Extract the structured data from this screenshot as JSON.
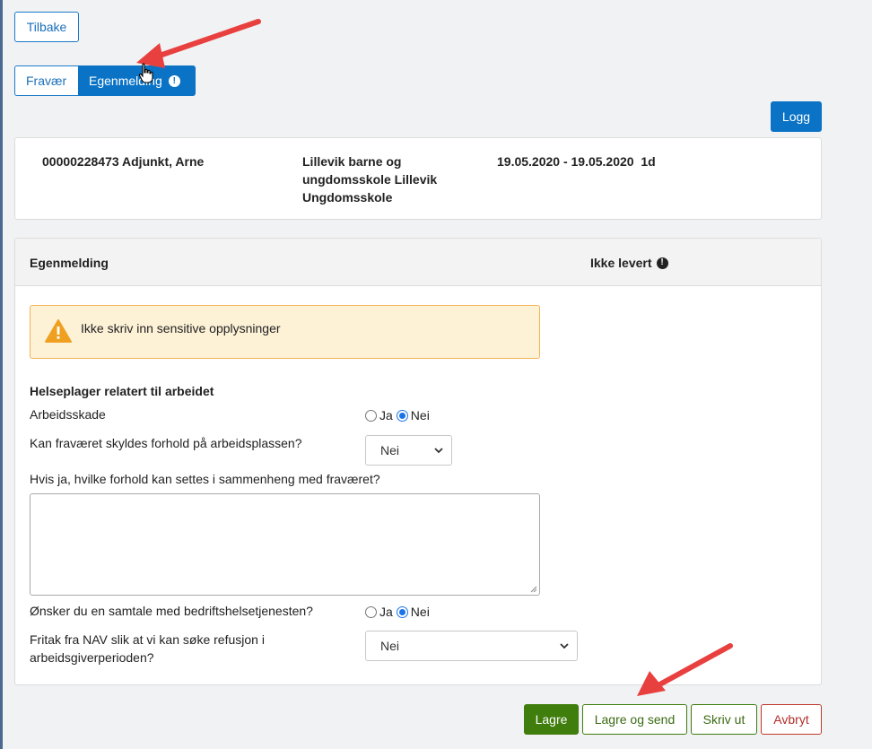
{
  "nav": {
    "back_label": "Tilbake"
  },
  "tabs": [
    {
      "label": "Fravær"
    },
    {
      "label": "Egenmelding"
    }
  ],
  "log_label": "Logg",
  "employee": {
    "name": "00000228473 Adjunkt, Arne",
    "school_line1": "Lillevik barne og",
    "school_line2": "ungdomsskole Lillevik",
    "school_line3": "Ungdomsskole",
    "period": "19.05.2020 - 19.05.2020",
    "duration": "1d"
  },
  "form": {
    "title": "Egenmelding",
    "status": "Ikke levert",
    "warning": "Ikke skriv inn sensitive opplysninger",
    "section_title": "Helseplager relatert til arbeidet",
    "q_injury": "Arbeidsskade",
    "q_workplace": "Kan fraværet skyldes forhold på arbeidsplassen?",
    "q_which": "Hvis ja, hvilke forhold kan settes i sammenheng med fraværet?",
    "q_talk": "Ønsker du en samtale med bedriftshelsetjenesten?",
    "q_nav_line1": "Fritak fra NAV slik at vi kan søke refusjon i",
    "q_nav_line2": "arbeidsgiverperioden?",
    "yes": "Ja",
    "no": "Nei",
    "select_workplace": "Nei",
    "select_nav": "Nei",
    "textarea_value": ""
  },
  "actions": {
    "save": "Lagre",
    "save_send": "Lagre og send",
    "print": "Skriv ut",
    "cancel": "Avbryt"
  },
  "colors": {
    "primary": "#0a73c6",
    "save_green": "#3f7d0d",
    "cancel_red": "#c0392b",
    "warning_bg": "#fdf1d6",
    "warning_icon": "#f0a020",
    "annotation_arrow": "#e8403f"
  }
}
